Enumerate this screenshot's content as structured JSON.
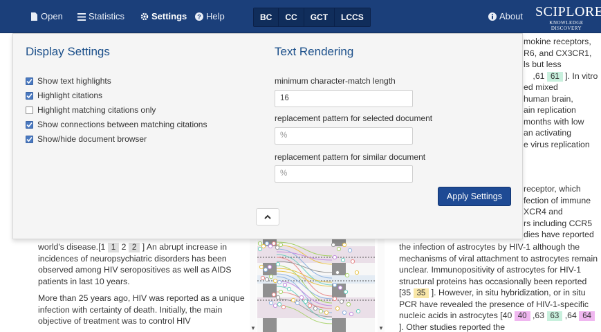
{
  "navbar": {
    "items": [
      {
        "label": "Open",
        "icon": "file-icon"
      },
      {
        "label": "Statistics",
        "icon": "list-icon"
      },
      {
        "label": "Settings",
        "icon": "gear-icon"
      },
      {
        "label": "Help",
        "icon": "help-icon"
      }
    ],
    "tabs": [
      "BC",
      "CC",
      "GCT",
      "LCCS"
    ],
    "about_label": "About",
    "logo_text": "SCIPLORE",
    "logo_subtext": "KNOWLEDGE DISCOVERY"
  },
  "settings_panel": {
    "display_title": "Display Settings",
    "checkboxes": [
      {
        "label": "Show text highlights",
        "checked": true
      },
      {
        "label": "Highlight citations",
        "checked": true
      },
      {
        "label": "Highlight matching citations only",
        "checked": false
      },
      {
        "label": "Show connections between matching citations",
        "checked": true
      },
      {
        "label": "Show/hide document browser",
        "checked": true
      }
    ],
    "text_title": "Text Rendering",
    "min_match_label": "minimum character-match length",
    "min_match_value": "16",
    "pattern_selected_label": "replacement pattern for selected document",
    "pattern_selected_placeholder": "%",
    "pattern_similar_label": "replacement pattern for similar document",
    "pattern_similar_placeholder": "%",
    "apply_label": "Apply Settings"
  },
  "left_document": {
    "paragraphs": [
      {
        "segments": [
          {
            "t": "world's disease.[1 "
          },
          {
            "t": "1",
            "h": "grey"
          },
          {
            "t": " 2 "
          },
          {
            "t": "2",
            "h": "grey"
          },
          {
            "t": " ] An abrupt increase in incidences of neuropsychiatric disorders has been observed among HIV seropositives as well as AIDS patients in last 10 years."
          }
        ]
      },
      {
        "segments": [
          {
            "t": "More than 25 years ago, HIV was reported as a unique infection with certainty of death. Initially, the main objective of treatment was to control HIV"
          }
        ]
      }
    ]
  },
  "right_document": {
    "top_lines": [
      {
        "segments": [
          {
            "t": "mokine receptors,"
          }
        ]
      },
      {
        "segments": [
          {
            "t": "R6, and CX3CR1,"
          }
        ]
      },
      {
        "segments": [
          {
            "t": "ls but less"
          }
        ]
      },
      {
        "segments": [
          {
            "t": "   ",
            "h": "yellow"
          },
          {
            "t": " ,61 "
          },
          {
            "t": "61",
            "h": "green"
          },
          {
            "t": " ]. In vitro"
          }
        ]
      },
      {
        "segments": [
          {
            "t": "ed mixed"
          }
        ]
      },
      {
        "segments": [
          {
            "t": "human brain,"
          }
        ]
      },
      {
        "segments": [
          {
            "t": "ain replication"
          }
        ]
      },
      {
        "segments": [
          {
            "t": "months with low"
          }
        ]
      },
      {
        "segments": [
          {
            "t": "an activating"
          }
        ]
      },
      {
        "segments": [
          {
            "t": "e virus replication"
          }
        ]
      }
    ],
    "middle_lines": [
      {
        "segments": [
          {
            "t": " receptor, which"
          }
        ]
      },
      {
        "segments": [
          {
            "t": "fection of immune"
          }
        ]
      },
      {
        "segments": [
          {
            "t": "XCR4 and"
          }
        ]
      },
      {
        "segments": [
          {
            "t": "rs including CCR5"
          }
        ]
      },
      {
        "segments": [
          {
            "t": "dies have reported"
          }
        ]
      }
    ],
    "paragraph": [
      {
        "t": "the infection of astrocytes by HIV-1 although the mechanisms of viral attachment to astrocytes remain unclear. Immunopositivity of astrocytes for HIV-1 structural proteins has occasionally been reported [35 "
      },
      {
        "t": "35",
        "h": "yellow"
      },
      {
        "t": " ]. However, in situ hybridization, or in situ PCR have revealed the presence of HIV-1-specific nucleic acids in astrocytes [40 "
      },
      {
        "t": "40",
        "h": "pink"
      },
      {
        "t": " ,63 "
      },
      {
        "t": "63",
        "h": "green"
      },
      {
        "t": " ,64 "
      },
      {
        "t": "64",
        "h": "pink"
      },
      {
        "t": " ]. Other studies reported the"
      }
    ]
  },
  "colors": {
    "navbar": "#1b3f7a",
    "tab_bg": "#102d5b",
    "primary_button": "#1e4a94",
    "panel_title": "#1b4f8a",
    "citation_yellow": "#f9e7a8",
    "citation_green": "#c8f0dd",
    "citation_pink": "#f0b7f0",
    "citation_grey": "#dedede",
    "connection_colors": [
      "#a8d26a",
      "#e8c44a",
      "#8fb3e0",
      "#c48fe0",
      "#6ccfc0",
      "#e88a8a",
      "#999999"
    ]
  }
}
